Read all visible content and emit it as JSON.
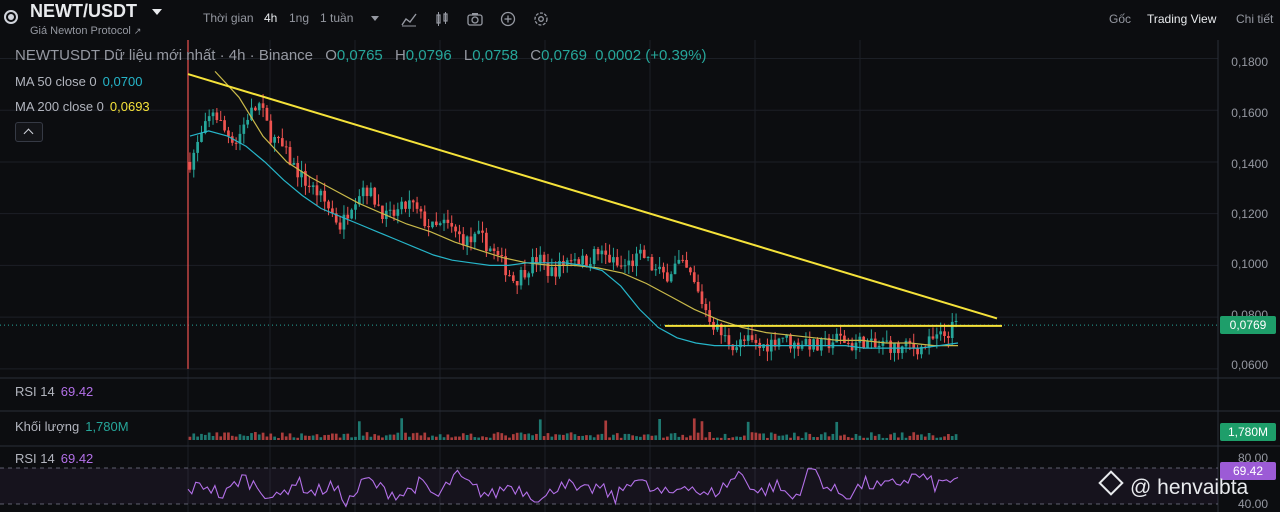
{
  "header": {
    "symbol": "NEWT/USDT",
    "subtitle": "Giá Newton Protocol",
    "timeframes": [
      "Thời gian",
      "4h",
      "1ng",
      "1 tuần"
    ],
    "active_timeframe": "4h",
    "tools": [
      "indicators-icon",
      "candle-type-icon",
      "camera-icon",
      "add-circle-icon",
      "settings-gear-icon"
    ],
    "right_tabs": [
      "Gốc",
      "Trading View",
      "Chi tiết"
    ],
    "active_right_tab": "Trading View"
  },
  "legend": {
    "title": "NEWTUSDT Dữ liệu mới nhất · 4h · Binance",
    "o_label": "O",
    "o": "0,0765",
    "h_label": "H",
    "h": "0,0796",
    "l_label": "L",
    "l": "0,0758",
    "c_label": "C",
    "c": "0,0769",
    "change": "0,0002 (+0.39%)",
    "ma50_label": "MA 50 close 0",
    "ma50_value": "0,0700",
    "ma200_label": "MA 200 close 0",
    "ma200_value": "0,0693"
  },
  "panes": {
    "rsi_top_label": "RSI 14",
    "rsi_top_value": "69.42",
    "volume_label": "Khối lượng",
    "volume_value": "1,780M",
    "rsi_label": "RSI 14",
    "rsi_value": "69.42"
  },
  "price_axis": {
    "ticks": [
      "0,1800",
      "0,1600",
      "0,1400",
      "0,1200",
      "0,1000",
      "0,0800",
      "0,0600"
    ],
    "current_price": "0,0769",
    "volume_tag": "1,780M",
    "rsi_ticks": [
      "80.00",
      "40.00"
    ],
    "rsi_tag": "69.42"
  },
  "watermark": "@ henvaibta",
  "colors": {
    "up": "#26a69a",
    "down": "#ef5350",
    "ma50": "#26b5c9",
    "ma200": "#c9b94a",
    "trendline": "#f5e23a",
    "rsi": "#b370e8",
    "background": "#0c0d10"
  },
  "chart_data": {
    "type": "candlestick",
    "interval": "4h",
    "ylim": [
      0.058,
      0.186
    ],
    "y_ticks": [
      0.18,
      0.16,
      0.14,
      0.12,
      0.1,
      0.08,
      0.06
    ],
    "last_close": 0.0769,
    "close_series_approx": [
      0.14,
      0.15,
      0.16,
      0.152,
      0.148,
      0.158,
      0.162,
      0.15,
      0.145,
      0.138,
      0.132,
      0.128,
      0.122,
      0.115,
      0.125,
      0.131,
      0.125,
      0.118,
      0.121,
      0.124,
      0.118,
      0.114,
      0.116,
      0.112,
      0.109,
      0.111,
      0.106,
      0.1,
      0.094,
      0.099,
      0.103,
      0.097,
      0.1,
      0.104,
      0.101,
      0.105,
      0.103,
      0.099,
      0.101,
      0.104,
      0.098,
      0.096,
      0.101,
      0.097,
      0.087,
      0.078,
      0.072,
      0.069,
      0.071,
      0.068,
      0.07,
      0.073,
      0.069,
      0.071,
      0.068,
      0.07,
      0.072,
      0.069,
      0.071,
      0.068,
      0.07,
      0.067,
      0.069,
      0.068,
      0.071,
      0.073,
      0.077
    ],
    "ma50_approx": [
      0.15,
      0.152,
      0.15,
      0.146,
      0.14,
      0.133,
      0.127,
      0.122,
      0.119,
      0.116,
      0.113,
      0.11,
      0.107,
      0.104,
      0.102,
      0.101,
      0.1,
      0.1,
      0.101,
      0.101,
      0.101,
      0.1,
      0.098,
      0.092,
      0.083,
      0.076,
      0.072,
      0.07,
      0.069,
      0.069,
      0.069,
      0.069,
      0.069,
      0.069,
      0.069,
      0.069,
      0.068,
      0.068,
      0.068,
      0.068,
      0.069,
      0.07
    ],
    "ma200_approx": [
      0.175,
      0.165,
      0.15,
      0.14,
      0.134,
      0.129,
      0.124,
      0.12,
      0.116,
      0.113,
      0.109,
      0.106,
      0.103,
      0.101,
      0.1,
      0.1,
      0.099,
      0.097,
      0.093,
      0.088,
      0.083,
      0.079,
      0.076,
      0.074,
      0.073,
      0.072,
      0.071,
      0.071,
      0.07,
      0.07,
      0.069,
      0.069
    ],
    "trendline": {
      "start": 0.174,
      "end": 0.0795
    },
    "support_line": 0.0766,
    "rsi_series_approx": [
      55,
      62,
      48,
      70,
      58,
      45,
      66,
      52,
      60,
      42,
      68,
      55,
      50,
      63,
      47,
      72,
      58,
      49,
      61,
      54,
      44,
      67,
      52,
      59,
      46,
      71,
      55,
      50,
      64,
      48,
      58,
      75,
      52,
      61,
      45,
      80,
      56,
      50,
      63,
      58,
      65,
      72,
      60,
      69
    ],
    "rsi_levels": [
      80,
      40
    ],
    "rsi_last": 69.42,
    "volume_last": "1,780M"
  }
}
